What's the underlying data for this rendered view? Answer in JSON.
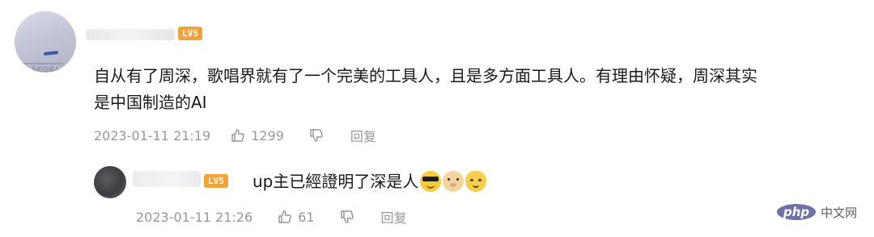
{
  "comment": {
    "user_level": "LV5",
    "avatar_caption": "...系的边缘人",
    "text_line1": "自从有了周深，歌唱界就有了一个完美的工具人，且是多方面工具人。有理由怀疑，周深其实",
    "text_line2": "是中国制造的AI",
    "timestamp": "2023-01-11 21:19",
    "like_count": "1299",
    "reply_label": "回复"
  },
  "reply": {
    "user_level": "LV5",
    "text": "up主已經證明了深是人",
    "emojis": [
      "cool-face-emoji",
      "doge-emoji",
      "cat-face-emoji"
    ],
    "timestamp": "2023-01-11 21:26",
    "like_count": "61",
    "reply_label": "回复"
  },
  "watermark": {
    "logo_text": "php",
    "site_text": "中文网"
  },
  "colors": {
    "text_primary": "#18191c",
    "text_meta": "#9499a0",
    "level_badge": "#f3a33a",
    "watermark_logo": "#6f72a8"
  }
}
